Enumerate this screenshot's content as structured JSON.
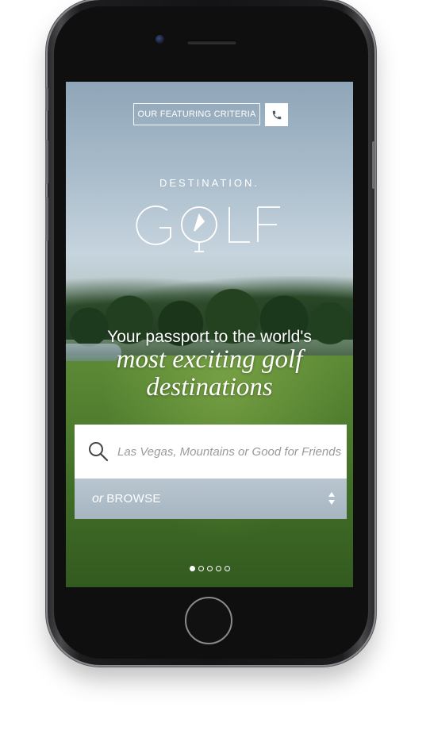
{
  "header": {
    "criteria_button": "OUR FEATURING CRITERIA",
    "call_icon": "phone-icon"
  },
  "brand": {
    "top_text": "DESTINATION.",
    "logo_text": "GOLF",
    "logo_icon": "compass-golf-tee-icon"
  },
  "hero": {
    "tagline_line1": "Your passport to the world's",
    "tagline_line2": "most exciting golf",
    "tagline_line3": "destinations"
  },
  "search": {
    "icon": "search-icon",
    "placeholder": "Las Vegas, Mountains or Good for Friends"
  },
  "browse": {
    "prefix": "or",
    "label": "BROWSE",
    "icon": "up-down-arrows-icon"
  },
  "carousel": {
    "total": 5,
    "active_index": 0
  },
  "colors": {
    "browse_bar": "#aebcc8",
    "search_bg": "#ffffff",
    "placeholder": "#9a9a9a"
  }
}
